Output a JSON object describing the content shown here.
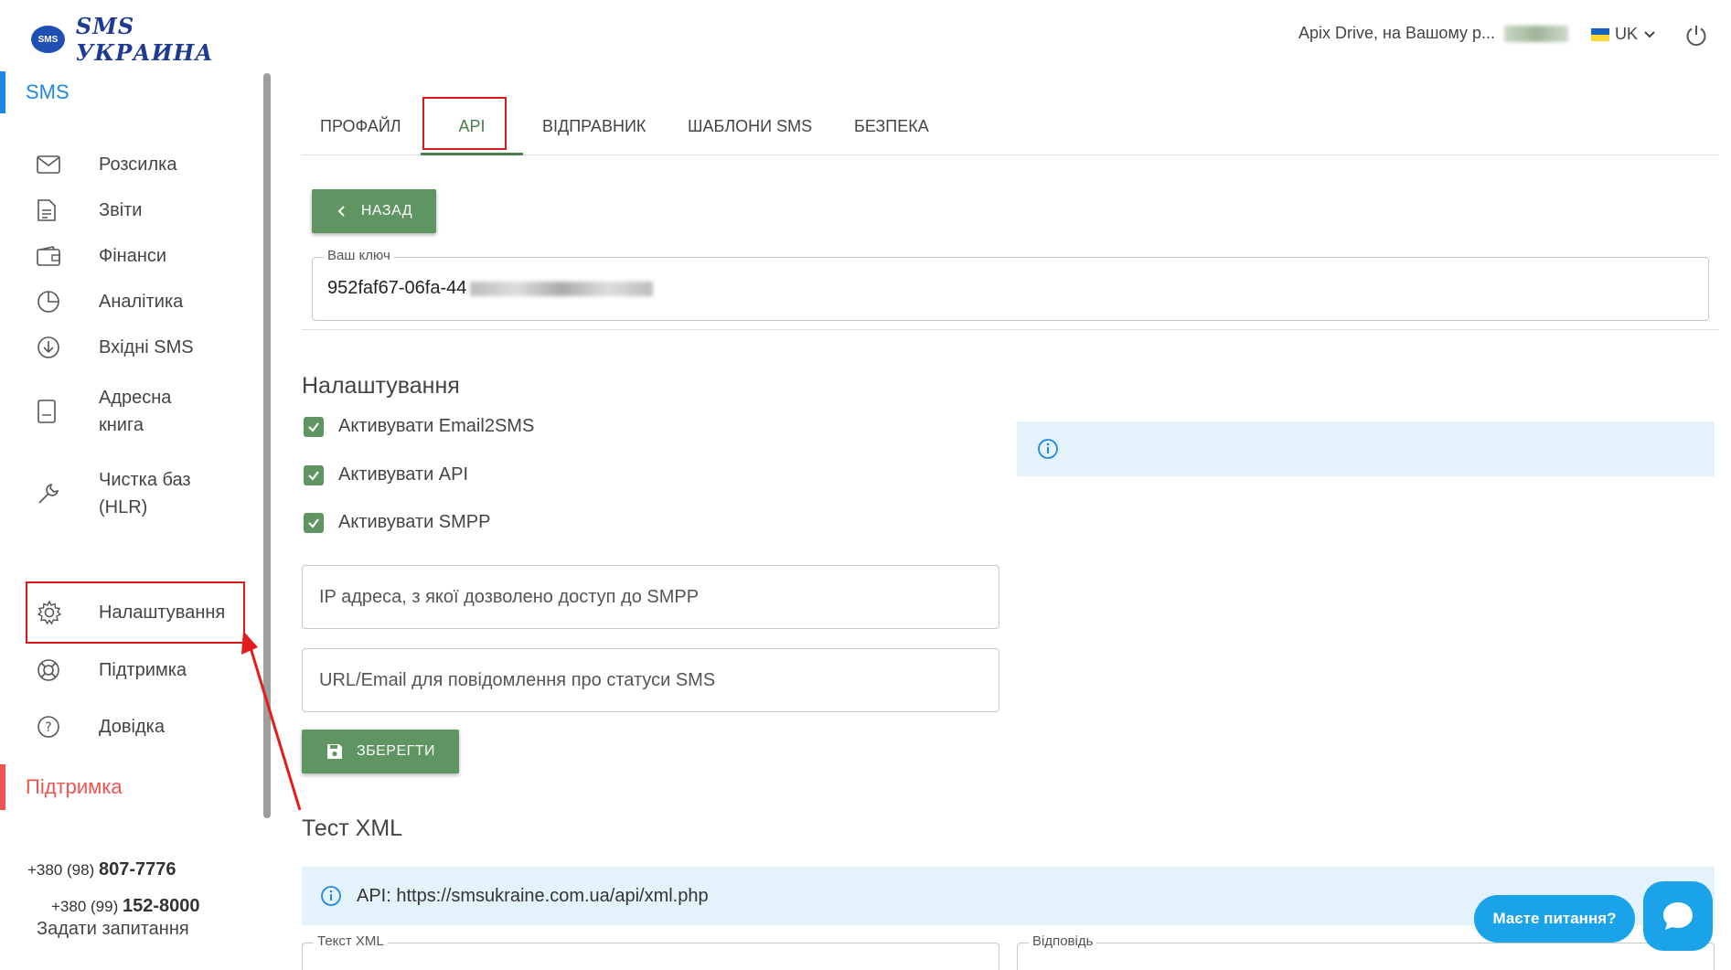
{
  "brand": {
    "badge": "SMS",
    "name": "SMS УКРАИНА"
  },
  "sidebar": {
    "section_title": "SMS",
    "items": [
      {
        "label": "Розсилка",
        "icon": "envelope-icon"
      },
      {
        "label": "Звіти",
        "icon": "document-icon"
      },
      {
        "label": "Фінанси",
        "icon": "wallet-icon"
      },
      {
        "label": "Аналітика",
        "icon": "pie-chart-icon"
      },
      {
        "label": "Вхідні SMS",
        "icon": "download-circle-icon"
      },
      {
        "label": "Адресна книга",
        "icon": "address-book-icon"
      },
      {
        "label": "Чистка баз (HLR)",
        "icon": "wrench-icon"
      },
      {
        "label": "Налаштування",
        "icon": "gear-icon"
      },
      {
        "label": "Підтримка",
        "icon": "lifebuoy-icon"
      },
      {
        "label": "Довідка",
        "icon": "help-circle-icon"
      }
    ],
    "support_title": "Підтримка",
    "phones": [
      {
        "prefix": "+380 (98)",
        "number": "807-7776"
      },
      {
        "prefix": "+380 (99)",
        "number": "152-8000"
      }
    ],
    "ask_question": "Задати запитання"
  },
  "header": {
    "user": "Apix Drive, на Вашому р...",
    "language": "UK"
  },
  "tabs": [
    {
      "label": "ПРОФАЙЛ"
    },
    {
      "label": "API"
    },
    {
      "label": "ВІДПРАВНИК"
    },
    {
      "label": "ШАБЛОНИ SMS"
    },
    {
      "label": "БЕЗПЕКА"
    }
  ],
  "main": {
    "back_label": "НАЗАД",
    "key_label": "Ваш ключ",
    "key_value": "952faf67-06fa-44",
    "settings_title": "Налаштування",
    "checkboxes": [
      {
        "label": "Активувати Email2SMS",
        "checked": true
      },
      {
        "label": "Активувати API",
        "checked": true
      },
      {
        "label": "Активувати SMPP",
        "checked": true
      }
    ],
    "ip_placeholder": "IP адреса, з якої дозволено доступ до SMPP",
    "url_placeholder": "URL/Email для повідомлення про статуси SMS",
    "save_label": "ЗБЕРЕГТИ",
    "xml_title": "Тест XML",
    "xml_api": "API: https://smsukraine.com.ua/api/xml.php",
    "xml_text_label": "Текст XML",
    "xml_response_label": "Відповідь"
  },
  "chat": {
    "prompt": "Маєте питання?"
  },
  "colors": {
    "accent_green": "#5f9463",
    "accent_blue": "#1e88e5",
    "support_red": "#ef5350",
    "chat_blue": "#1aa3e8"
  }
}
